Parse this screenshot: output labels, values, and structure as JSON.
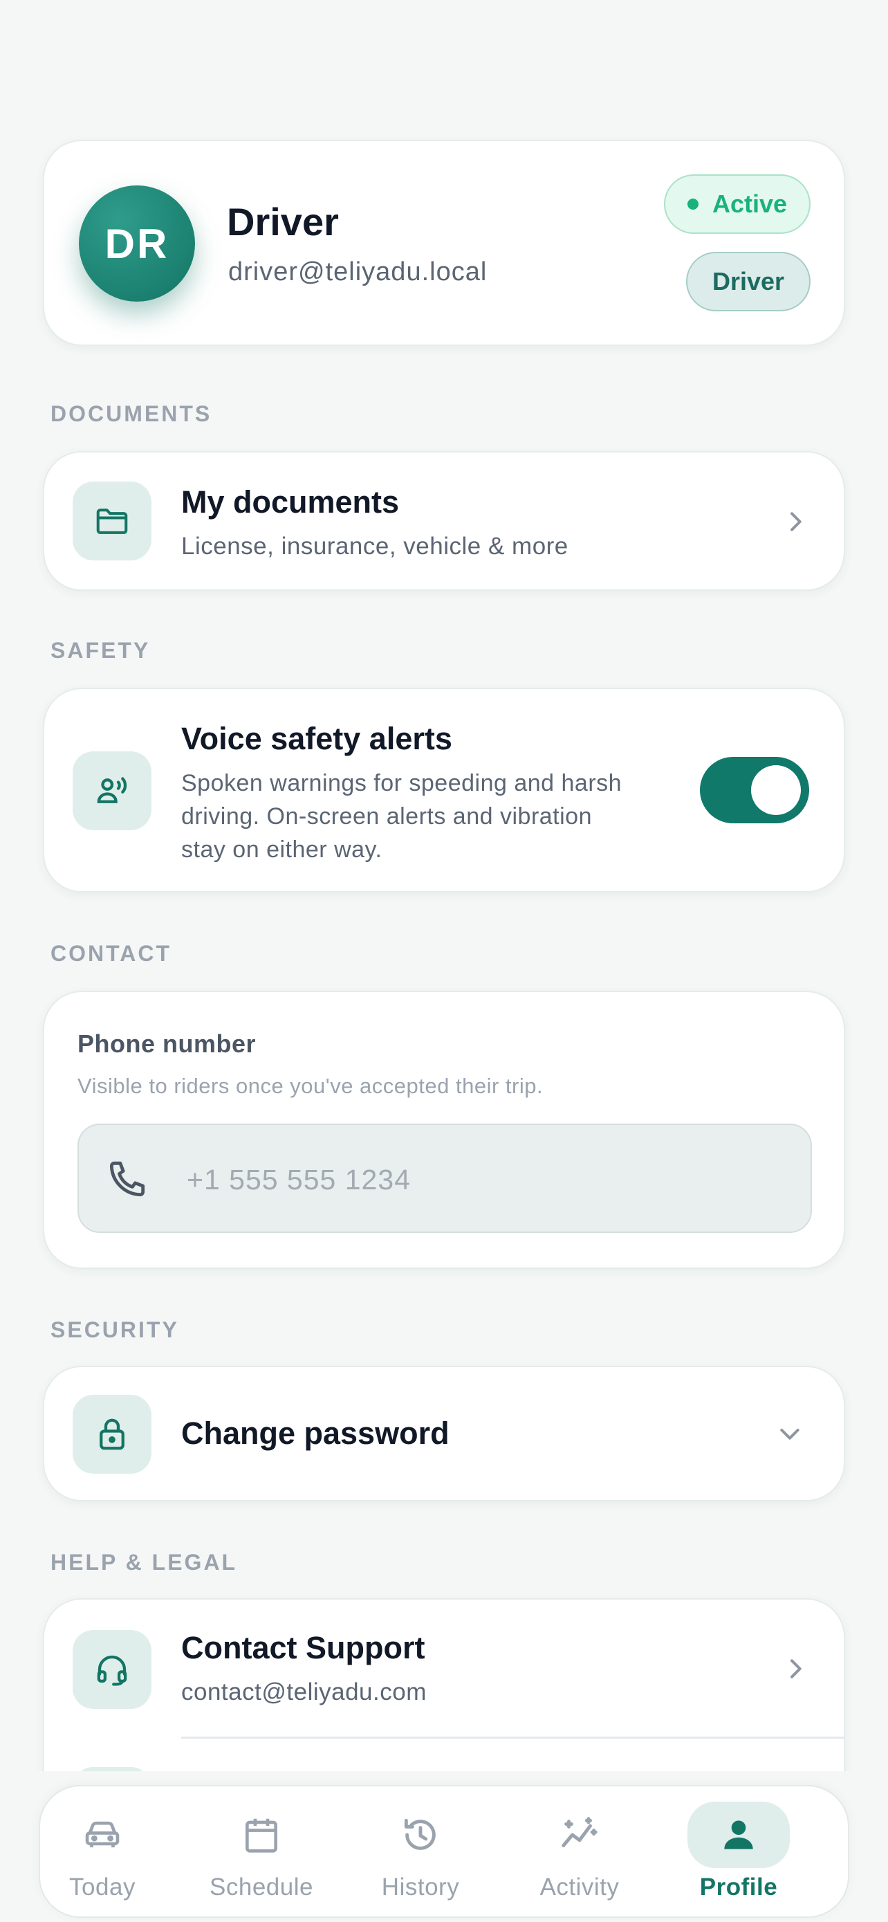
{
  "profile": {
    "initials": "DR",
    "name": "Driver",
    "email": "driver@teliyadu.local",
    "status_badge": "Active",
    "role_badge": "Driver"
  },
  "documents": {
    "section_label": "DOCUMENTS",
    "title": "My documents",
    "subtitle": "License, insurance, vehicle & more"
  },
  "safety": {
    "section_label": "SAFETY",
    "title": "Voice safety alerts",
    "description_lines": [
      "Spoken warnings for speeding and harsh",
      "driving. On-screen alerts and vibration",
      "stay on either way."
    ],
    "toggle_on": true
  },
  "contact": {
    "section_label": "CONTACT",
    "field_label": "Phone number",
    "field_hint": "Visible to riders once you've accepted their trip.",
    "phone_placeholder": "+1 555 555 1234",
    "phone_value": ""
  },
  "security": {
    "section_label": "SECURITY",
    "title": "Change password"
  },
  "help": {
    "section_label": "HELP & LEGAL",
    "support_title": "Contact Support",
    "support_email": "contact@teliyadu.com"
  },
  "nav": {
    "items": [
      {
        "label": "Today",
        "icon": "car-icon"
      },
      {
        "label": "Schedule",
        "icon": "calendar-icon"
      },
      {
        "label": "History",
        "icon": "history-icon"
      },
      {
        "label": "Activity",
        "icon": "activity-icon"
      },
      {
        "label": "Profile",
        "icon": "person-icon"
      }
    ],
    "active_index": 4
  },
  "colors": {
    "accent": "#137564",
    "background": "#f5f7f7",
    "active_green": "#19b27a"
  }
}
